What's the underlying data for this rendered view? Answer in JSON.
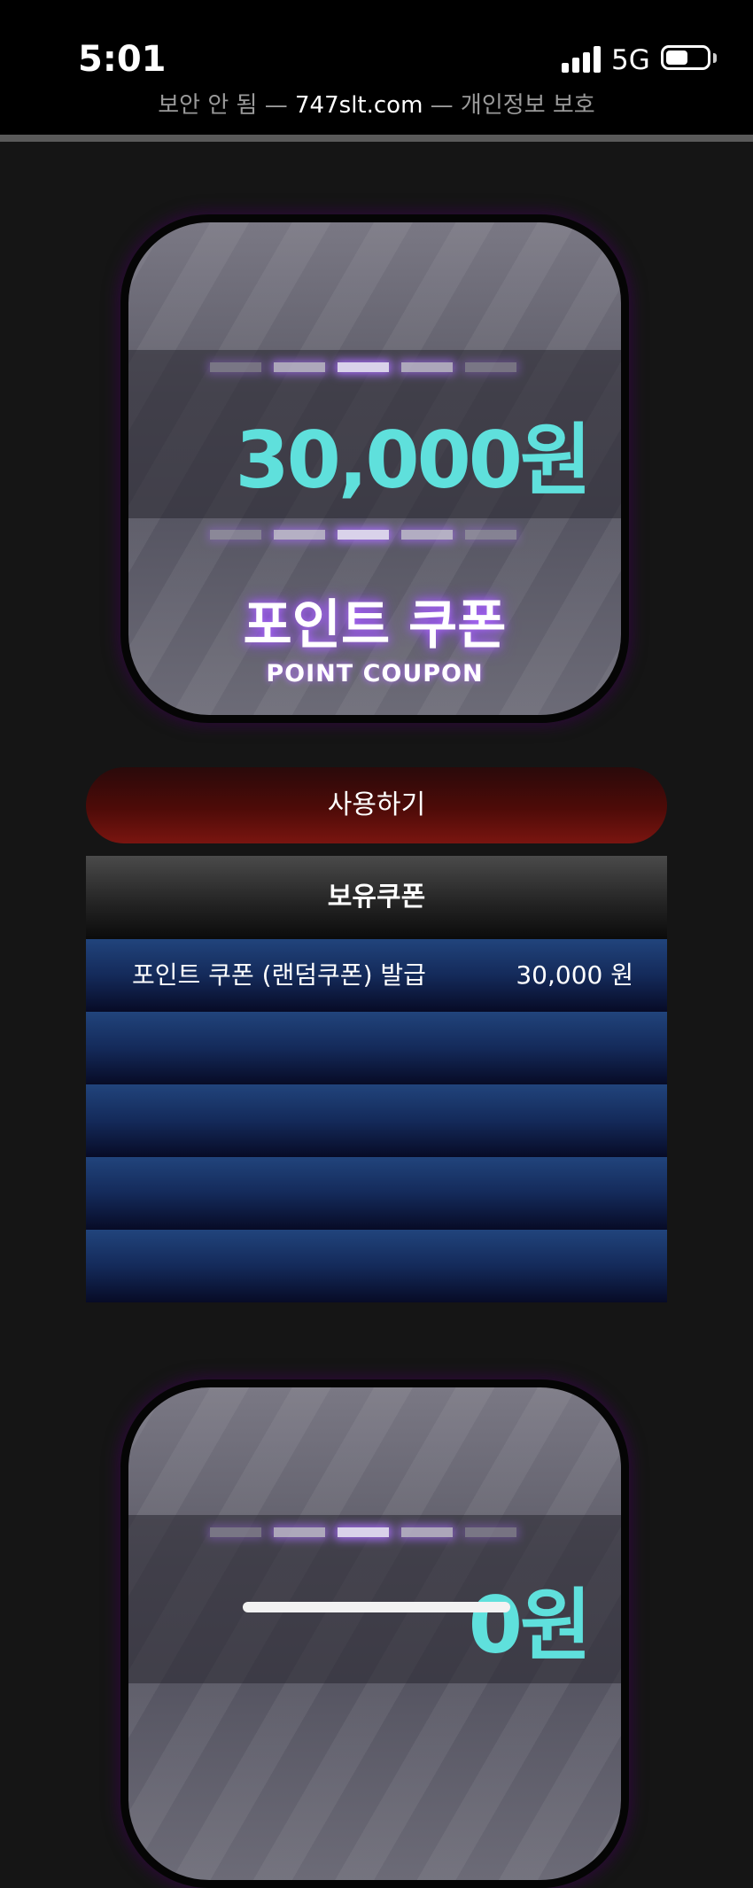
{
  "status": {
    "time": "5:01",
    "network": "5G"
  },
  "url_bar": {
    "prefix": "보안 안 됨 —",
    "domain": "747slt.com",
    "suffix": "— 개인정보 보호"
  },
  "coupons": [
    {
      "amount": "30,000원",
      "title_ko": "포인트 쿠폰",
      "title_en": "POINT COUPON"
    },
    {
      "amount": "0원"
    }
  ],
  "use_button_label": "사용하기",
  "held": {
    "header": "보유쿠폰",
    "rows": [
      {
        "name": "포인트 쿠폰 (랜덤쿠폰) 발급",
        "value": "30,000 원"
      },
      {
        "name": "",
        "value": ""
      },
      {
        "name": "",
        "value": ""
      },
      {
        "name": "",
        "value": ""
      },
      {
        "name": "",
        "value": ""
      }
    ]
  },
  "colors": {
    "amount": "#5fe0dc",
    "glow": "#b06bff",
    "button": "#7a1510",
    "row": "#142a5a"
  }
}
